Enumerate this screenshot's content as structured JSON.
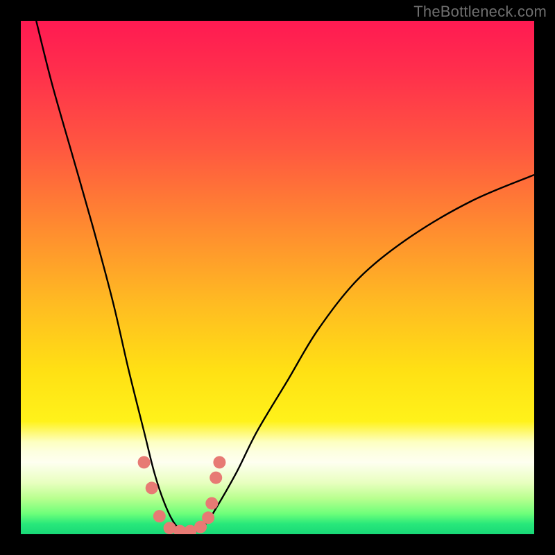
{
  "watermark": "TheBottleneck.com",
  "chart_data": {
    "type": "line",
    "title": "",
    "xlabel": "",
    "ylabel": "",
    "xlim": [
      0,
      100
    ],
    "ylim": [
      0,
      100
    ],
    "grid": false,
    "series": [
      {
        "name": "bottleneck-curve",
        "x": [
          3,
          6,
          10,
          14,
          18,
          21,
          24,
          26,
          28,
          30,
          32,
          34,
          36,
          38,
          42,
          46,
          52,
          58,
          66,
          76,
          88,
          100
        ],
        "y": [
          100,
          88,
          74,
          60,
          45,
          32,
          20,
          12,
          6,
          2,
          0.5,
          0.5,
          2,
          5,
          12,
          20,
          30,
          40,
          50,
          58,
          65,
          70
        ]
      }
    ],
    "markers": {
      "name": "highlight-dots",
      "color": "#e77a74",
      "points_xy": [
        [
          24,
          14
        ],
        [
          25.5,
          9
        ],
        [
          27,
          3.5
        ],
        [
          29,
          1.2
        ],
        [
          31,
          0.6
        ],
        [
          33,
          0.6
        ],
        [
          35,
          1.4
        ],
        [
          36.5,
          3.2
        ],
        [
          37.2,
          6
        ],
        [
          38,
          11
        ],
        [
          38.7,
          14
        ]
      ]
    }
  }
}
